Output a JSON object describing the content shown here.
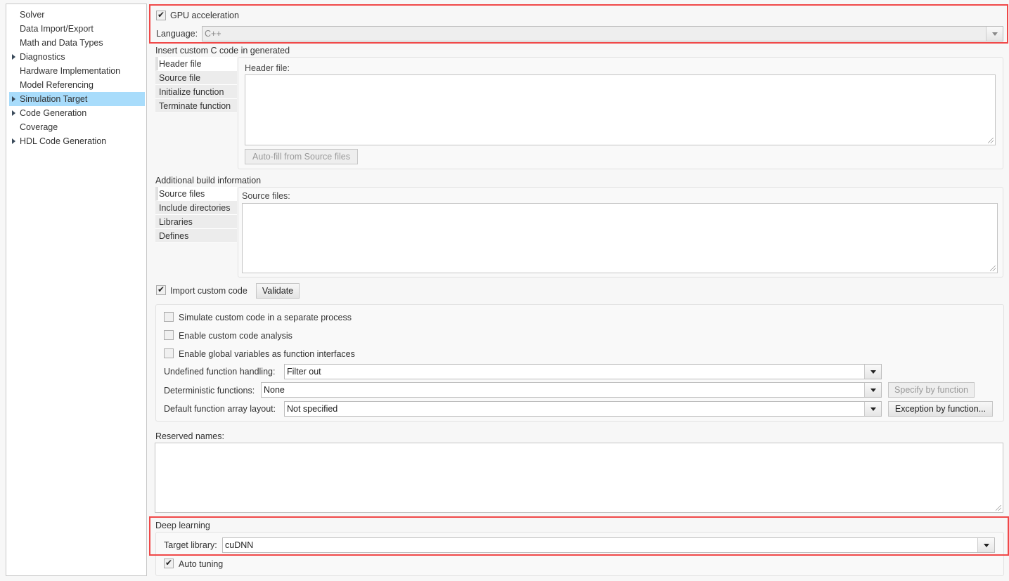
{
  "sidebar": {
    "items": [
      {
        "label": "Solver",
        "expandable": false
      },
      {
        "label": "Data Import/Export",
        "expandable": false
      },
      {
        "label": "Math and Data Types",
        "expandable": false
      },
      {
        "label": "Diagnostics",
        "expandable": true
      },
      {
        "label": "Hardware Implementation",
        "expandable": false
      },
      {
        "label": "Model Referencing",
        "expandable": false
      },
      {
        "label": "Simulation Target",
        "expandable": true,
        "selected": true
      },
      {
        "label": "Code Generation",
        "expandable": true
      },
      {
        "label": "Coverage",
        "expandable": false
      },
      {
        "label": "HDL Code Generation",
        "expandable": true
      }
    ]
  },
  "gpu": {
    "label": "GPU acceleration",
    "checked": true,
    "language_label": "Language:",
    "language_value": "C++"
  },
  "custom_code": {
    "title": "Insert custom C code in generated",
    "tabs": [
      "Header file",
      "Source file",
      "Initialize function",
      "Terminate function"
    ],
    "field_label": "Header file:",
    "autofill": "Auto-fill from Source files"
  },
  "build_info": {
    "title": "Additional build information",
    "tabs": [
      "Source files",
      "Include directories",
      "Libraries",
      "Defines"
    ],
    "field_label": "Source files:"
  },
  "import": {
    "label": "Import custom code",
    "checked": true,
    "validate": "Validate"
  },
  "options": {
    "simulate_separate": "Simulate custom code in a separate process",
    "enable_analysis": "Enable custom code analysis",
    "enable_globals": "Enable global variables as function interfaces",
    "undefined_label": "Undefined function handling:",
    "undefined_value": "Filter out",
    "deterministic_label": "Deterministic functions:",
    "deterministic_value": "None",
    "specify_btn": "Specify by function",
    "array_label": "Default function array layout:",
    "array_value": "Not specified",
    "exception_btn": "Exception by function..."
  },
  "reserved": {
    "label": "Reserved names:"
  },
  "deep_learning": {
    "title": "Deep learning",
    "target_label": "Target library:",
    "target_value": "cuDNN",
    "auto_tuning": "Auto tuning",
    "auto_tuning_checked": true
  },
  "colors": {
    "highlight": "#f04848",
    "selected": "#a8dcfb"
  }
}
